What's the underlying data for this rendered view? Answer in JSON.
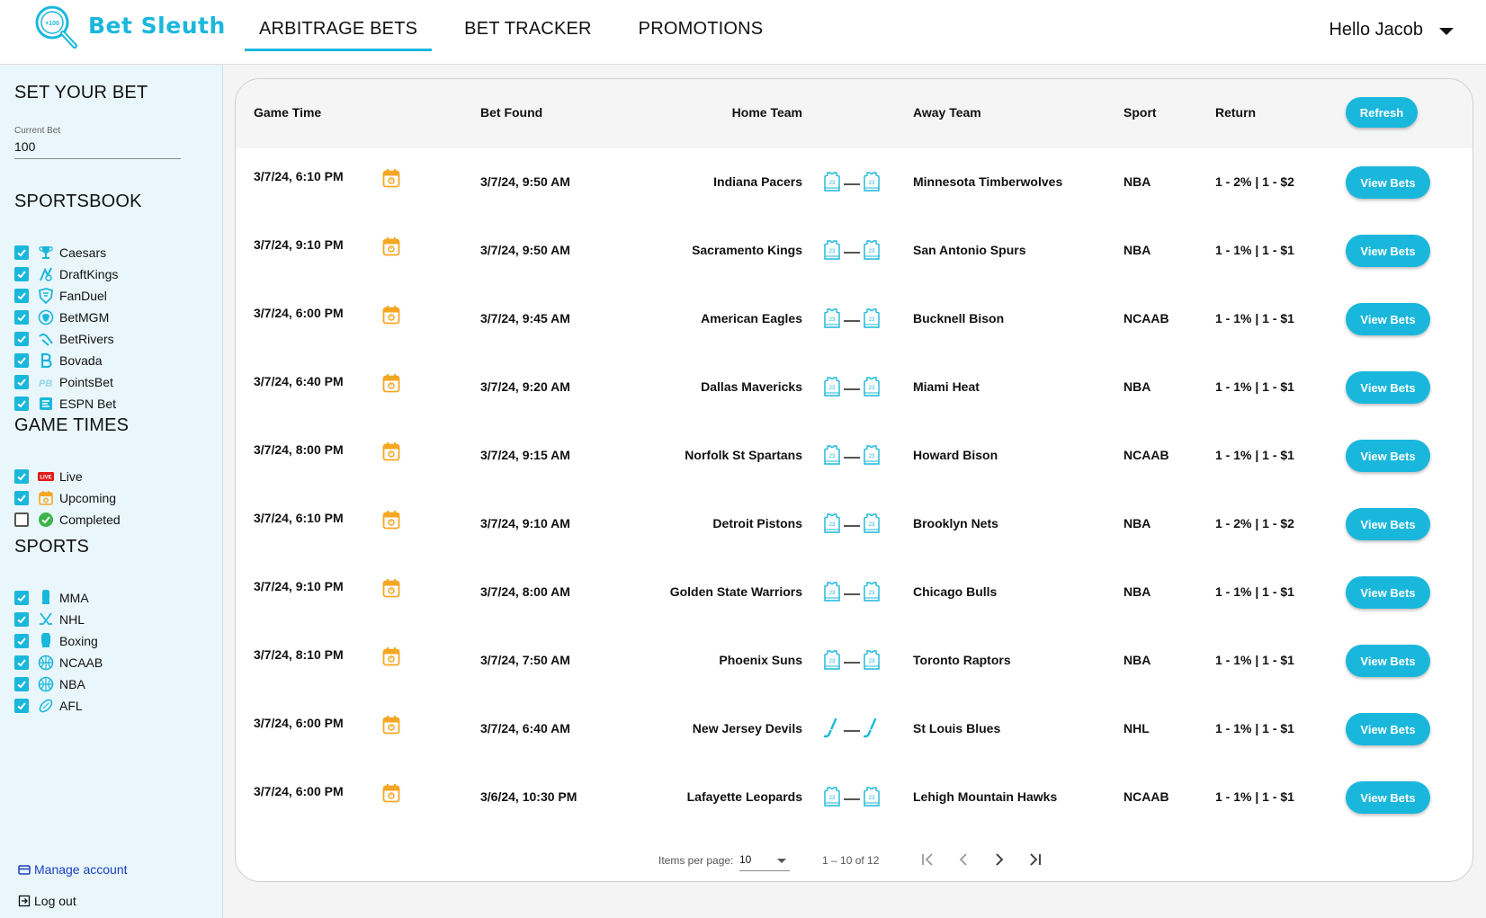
{
  "app": {
    "name": "Bet Sleuth",
    "brand_color": "#1ab7dc"
  },
  "nav": {
    "tabs": [
      {
        "label": "ARBITRAGE BETS",
        "active": true
      },
      {
        "label": "BET TRACKER",
        "active": false
      },
      {
        "label": "PROMOTIONS",
        "active": false
      }
    ],
    "user_greeting": "Hello Jacob"
  },
  "sidebar": {
    "set_bet": {
      "title": "SET YOUR BET",
      "field_label": "Current Bet",
      "field_value": "100"
    },
    "sportsbook": {
      "title": "SPORTSBOOK",
      "items": [
        {
          "label": "Caesars",
          "checked": true,
          "icon": "trophy-icon"
        },
        {
          "label": "DraftKings",
          "checked": true,
          "icon": "draftkings-icon"
        },
        {
          "label": "FanDuel",
          "checked": true,
          "icon": "fanduel-shield-icon"
        },
        {
          "label": "BetMGM",
          "checked": true,
          "icon": "lion-icon"
        },
        {
          "label": "BetRivers",
          "checked": true,
          "icon": "wave-icon"
        },
        {
          "label": "Bovada",
          "checked": true,
          "icon": "bovada-b-icon"
        },
        {
          "label": "PointsBet",
          "checked": true,
          "icon": "pointsbet-icon"
        },
        {
          "label": "ESPN Bet",
          "checked": true,
          "icon": "espn-bet-icon"
        }
      ]
    },
    "game_times": {
      "title": "GAME TIMES",
      "items": [
        {
          "label": "Live",
          "checked": true,
          "icon": "live-badge-icon",
          "icon_text": "LIVE"
        },
        {
          "label": "Upcoming",
          "checked": true,
          "icon": "calendar-icon"
        },
        {
          "label": "Completed",
          "checked": false,
          "icon": "check-circle-icon"
        }
      ]
    },
    "sports": {
      "title": "SPORTS",
      "items": [
        {
          "label": "MMA",
          "checked": true,
          "icon": "glove-icon"
        },
        {
          "label": "NHL",
          "checked": true,
          "icon": "hockey-sticks-icon"
        },
        {
          "label": "Boxing",
          "checked": true,
          "icon": "boxing-glove-icon"
        },
        {
          "label": "NCAAB",
          "checked": true,
          "icon": "basketball-icon"
        },
        {
          "label": "NBA",
          "checked": true,
          "icon": "basketball-icon"
        },
        {
          "label": "AFL",
          "checked": true,
          "icon": "football-icon"
        }
      ]
    },
    "manage_account": "Manage account",
    "log_out": "Log out"
  },
  "table": {
    "headers": {
      "game_time": "Game Time",
      "bet_found": "Bet Found",
      "home_team": "Home Team",
      "away_team": "Away Team",
      "sport": "Sport",
      "return": "Return"
    },
    "refresh_label": "Refresh",
    "view_label": "View Bets",
    "rows": [
      {
        "game_time": "3/7/24, 6:10 PM",
        "bet_found": "3/7/24, 9:50 AM",
        "home": "Indiana Pacers",
        "away": "Minnesota Timberwolves",
        "sport": "NBA",
        "ret": "1 - 2% | 1 - $2",
        "icon": "jersey"
      },
      {
        "game_time": "3/7/24, 9:10 PM",
        "bet_found": "3/7/24, 9:50 AM",
        "home": "Sacramento Kings",
        "away": "San Antonio Spurs",
        "sport": "NBA",
        "ret": "1 - 1% | 1 - $1",
        "icon": "jersey"
      },
      {
        "game_time": "3/7/24, 6:00 PM",
        "bet_found": "3/7/24, 9:45 AM",
        "home": "American Eagles",
        "away": "Bucknell Bison",
        "sport": "NCAAB",
        "ret": "1 - 1% | 1 - $1",
        "icon": "jersey"
      },
      {
        "game_time": "3/7/24, 6:40 PM",
        "bet_found": "3/7/24, 9:20 AM",
        "home": "Dallas Mavericks",
        "away": "Miami Heat",
        "sport": "NBA",
        "ret": "1 - 1% | 1 - $1",
        "icon": "jersey"
      },
      {
        "game_time": "3/7/24, 8:00 PM",
        "bet_found": "3/7/24, 9:15 AM",
        "home": "Norfolk St Spartans",
        "away": "Howard Bison",
        "sport": "NCAAB",
        "ret": "1 - 1% | 1 - $1",
        "icon": "jersey"
      },
      {
        "game_time": "3/7/24, 6:10 PM",
        "bet_found": "3/7/24, 9:10 AM",
        "home": "Detroit Pistons",
        "away": "Brooklyn Nets",
        "sport": "NBA",
        "ret": "1 - 2% | 1 - $2",
        "icon": "jersey"
      },
      {
        "game_time": "3/7/24, 9:10 PM",
        "bet_found": "3/7/24, 8:00 AM",
        "home": "Golden State Warriors",
        "away": "Chicago Bulls",
        "sport": "NBA",
        "ret": "1 - 1% | 1 - $1",
        "icon": "jersey"
      },
      {
        "game_time": "3/7/24, 8:10 PM",
        "bet_found": "3/7/24, 7:50 AM",
        "home": "Phoenix Suns",
        "away": "Toronto Raptors",
        "sport": "NBA",
        "ret": "1 - 1% | 1 - $1",
        "icon": "jersey"
      },
      {
        "game_time": "3/7/24, 6:00 PM",
        "bet_found": "3/7/24, 6:40 AM",
        "home": "New Jersey Devils",
        "away": "St Louis Blues",
        "sport": "NHL",
        "ret": "1 - 1% | 1 - $1",
        "icon": "hockey-stick"
      },
      {
        "game_time": "3/7/24, 6:00 PM",
        "bet_found": "3/6/24, 10:30 PM",
        "home": "Lafayette Leopards",
        "away": "Lehigh Mountain Hawks",
        "sport": "NCAAB",
        "ret": "1 - 1% | 1 - $1",
        "icon": "jersey"
      }
    ]
  },
  "paginator": {
    "items_per_page_label": "Items per page:",
    "items_per_page_value": "10",
    "range_label": "1 – 10 of 12"
  }
}
